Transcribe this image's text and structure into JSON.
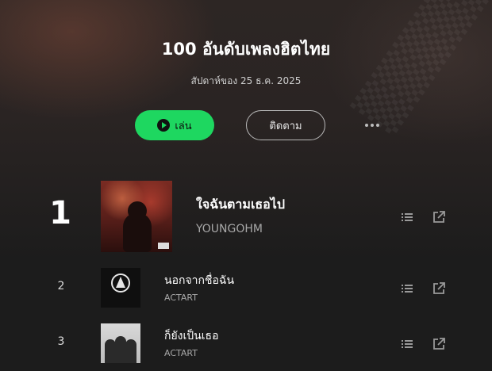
{
  "header": {
    "title": "100 อันดับเพลงฮิตไทย",
    "subtitle": "สัปดาห์ของ 25 ธ.ค. 2025",
    "play_label": "เล่น",
    "follow_label": "ติดตาม"
  },
  "colors": {
    "accent": "#1ed760",
    "background": "#1c1c1c"
  },
  "tracks": [
    {
      "rank": "1",
      "title": "ใจฉันตามเธอไป",
      "artist": "YOUNGOHM"
    },
    {
      "rank": "2",
      "title": "นอกจากชื่อฉัน",
      "artist": "ACTART"
    },
    {
      "rank": "3",
      "title": "ก็ยังเป็นเธอ",
      "artist": "ACTART"
    }
  ],
  "icons": {
    "play": "play-circle-icon",
    "more": "more-dots-icon",
    "add_to_queue": "queue-list-icon",
    "open": "open-external-icon"
  }
}
